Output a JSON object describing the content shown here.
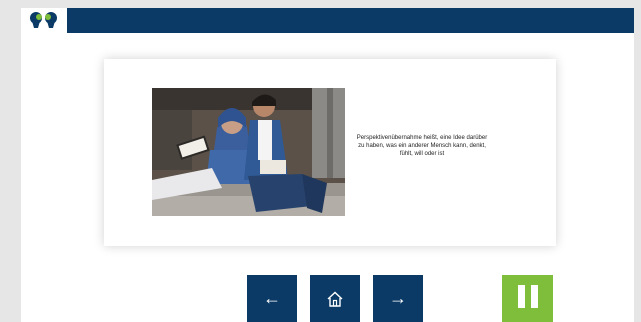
{
  "header": {
    "logo_icon": "two-heads-logo-icon",
    "bar_color": "#0b3a66"
  },
  "card": {
    "image_alt": "Two young people sitting on steps reading books together",
    "caption": "Perspektivenübernahme heißt, eine Idee darüber zu haben, was ein anderer Mensch kann, denkt, fühlt, will oder ist"
  },
  "controls": {
    "back_glyph": "←",
    "home_icon": "home-icon",
    "forward_glyph": "→",
    "pause_icon": "pause-icon",
    "accent_color": "#7fbe3a"
  }
}
